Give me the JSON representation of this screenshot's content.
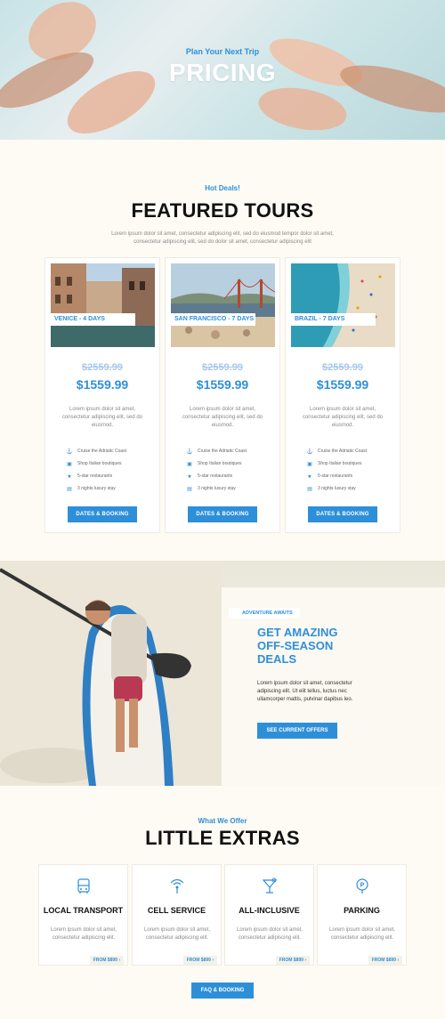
{
  "hero": {
    "eyebrow": "Plan Your Next Trip",
    "title": "PRICING"
  },
  "featured": {
    "eyebrow": "Hot Deals!",
    "title": "FEATURED TOURS",
    "intro": "Lorem ipsum dolor sit amet, consectetur adipiscing elit, sed do eiusmod tempor dolor sit amet, consectetur adipiscing elit, sed do dolor sit amet, consectetur adipiscing elit",
    "tours": [
      {
        "tag": "VENICE - 4 DAYS",
        "old_price": "$2559.99",
        "price": "$1559.99",
        "desc": "Lorem ipsum dolor sit amet, consectetur adipiscing elit, sed do eiusmod.",
        "features": [
          "Cruise the Adriatic Coast",
          "Shop Italian boutiques",
          "5-star restaurants",
          "3 nights luxury stay"
        ],
        "button": "DATES & BOOKING"
      },
      {
        "tag": "SAN FRANCISCO - 7 DAYS",
        "old_price": "$2559.99",
        "price": "$1559.99",
        "desc": "Lorem ipsum dolor sit amet, consectetur adipiscing elit, sed do eiusmod.",
        "features": [
          "Cruise the Adriatic Coast",
          "Shop Italian boutiques",
          "5-star restaurants",
          "3 nights luxury stay"
        ],
        "button": "DATES & BOOKING"
      },
      {
        "tag": "BRAZIL - 7 DAYS",
        "old_price": "$2559.99",
        "price": "$1559.99",
        "desc": "Lorem ipsum dolor sit amet, consectetur adipiscing elit, sed do eiusmod.",
        "features": [
          "Cruise the Adriatic Coast",
          "Shop Italian boutiques",
          "5-star restaurants",
          "3 nights luxury stay"
        ],
        "button": "DATES & BOOKING"
      }
    ]
  },
  "adventure": {
    "tag": "ADVENTURE AWAITS",
    "title_lines": [
      "GET AMAZING",
      "OFF-SEASON",
      "DEALS"
    ],
    "text": "Lorem ipsum dolor sit amet, consectetur adipiscing elit. Ut elit tellus, luctus nec ullamcorper mattis, pulvinar dapibus leo.",
    "button": "SEE CURRENT OFFERS"
  },
  "extras": {
    "eyebrow": "What We Offer",
    "title": "LITTLE EXTRAS",
    "items": [
      {
        "title": "LOCAL TRANSPORT",
        "desc": "Lorem ipsum dolor sit amet, consectetur adipiscing elit.",
        "price": "FROM $899  ›",
        "icon": "bus-icon"
      },
      {
        "title": "CELL SERVICE",
        "desc": "Lorem ipsum dolor sit amet, consectetur adipiscing elit.",
        "price": "FROM $899  ›",
        "icon": "signal-icon"
      },
      {
        "title": "ALL-INCLUSIVE",
        "desc": "Lorem ipsum dolor sit amet, consectetur adipiscing elit.",
        "price": "FROM $899  ›",
        "icon": "cocktail-icon"
      },
      {
        "title": "PARKING",
        "desc": "Lorem ipsum dolor sit amet, consectetur adipiscing elit.",
        "price": "FROM $899  ›",
        "icon": "parking-pin-icon"
      }
    ],
    "button": "FAQ & BOOKING"
  },
  "colors": {
    "accent": "#2e8fd9",
    "background": "#fdfbf4",
    "heading": "#111111",
    "muted": "#888888"
  }
}
